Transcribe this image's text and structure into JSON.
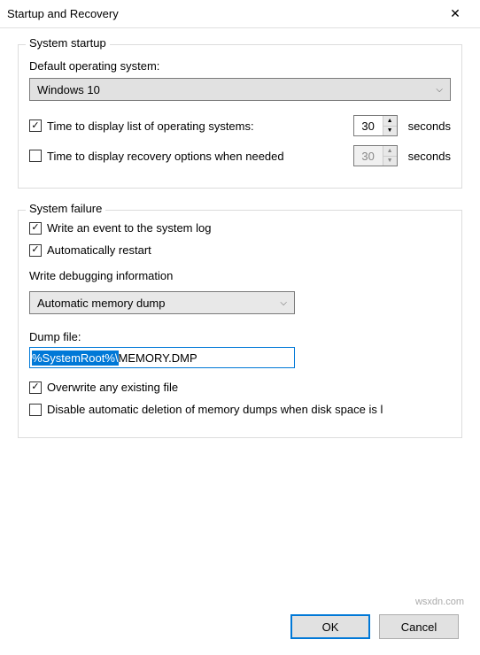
{
  "dialog": {
    "title": "Startup and Recovery"
  },
  "startup": {
    "group_label": "System startup",
    "default_os_label": "Default operating system:",
    "default_os_value": "Windows 10",
    "display_os_list_label": "Time to display list of operating systems:",
    "display_os_list_seconds": "30",
    "display_recovery_label": "Time to display recovery options when needed",
    "display_recovery_seconds": "30",
    "seconds_suffix": "seconds"
  },
  "failure": {
    "group_label": "System failure",
    "write_event_label": "Write an event to the system log",
    "auto_restart_label": "Automatically restart",
    "debug_info_label": "Write debugging information",
    "debug_info_value": "Automatic memory dump",
    "dump_file_label": "Dump file:",
    "dump_file_selected": "%SystemRoot%\\",
    "dump_file_rest": "MEMORY.DMP",
    "overwrite_label": "Overwrite any existing file",
    "disable_auto_delete_label": "Disable automatic deletion of memory dumps when disk space is l"
  },
  "buttons": {
    "ok": "OK",
    "cancel": "Cancel"
  },
  "watermark": "wsxdn.com"
}
